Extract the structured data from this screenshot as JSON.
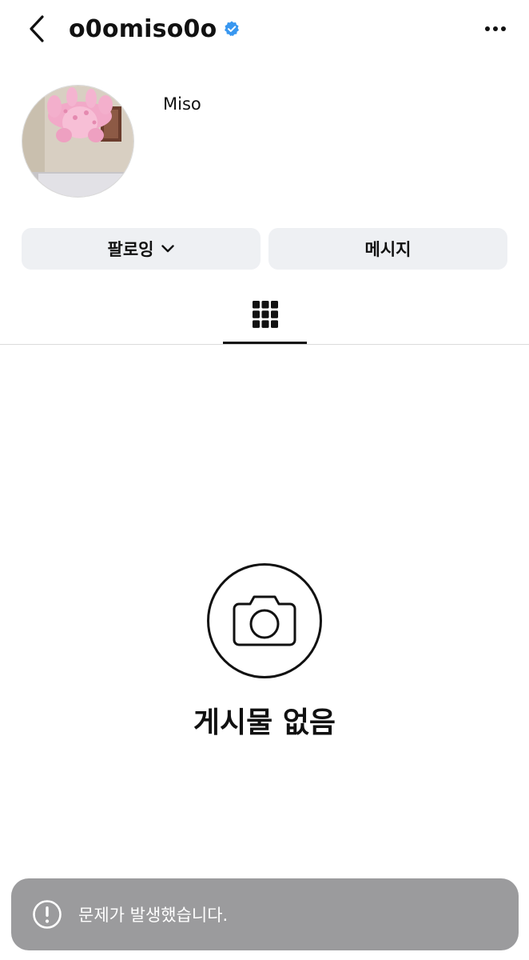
{
  "header": {
    "back_icon": "chevron-left-icon",
    "username": "o0omiso0o",
    "verified_icon": "verified-badge-icon",
    "verified_color": "#3897f0",
    "more_icon": "more-horizontal-icon"
  },
  "profile": {
    "display_name": "Miso",
    "avatar_description": "pink plush toy"
  },
  "actions": {
    "follow_label": "팔로잉",
    "follow_icon": "chevron-down-icon",
    "message_label": "메시지"
  },
  "tabs": {
    "active": "grid",
    "grid_icon": "grid-icon"
  },
  "empty_state": {
    "icon": "camera-icon",
    "title": "게시물 없음"
  },
  "toast": {
    "icon": "alert-circle-icon",
    "message": "문제가 발생했습니다.",
    "background": "#9b9b9d"
  }
}
